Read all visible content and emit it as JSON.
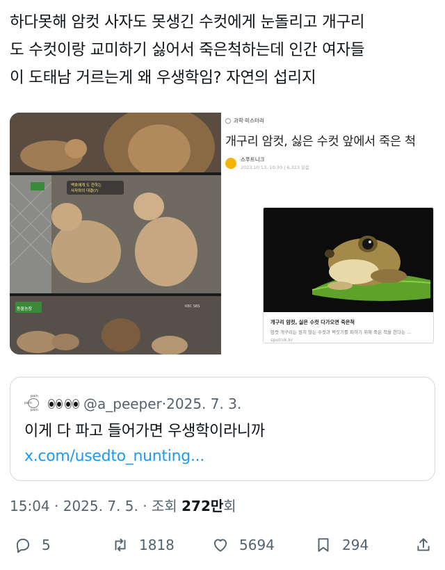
{
  "tweet": {
    "lines": [
      "하다못해 암컷 사자도 못생긴 수컷에게 눈돌리고 개구리",
      "도 수컷이랑 교미하기 싫어서 죽은척하는데 인간 여자들",
      "이 도태남 거르는게 왜 우생학임? 자연의 섭리지"
    ]
  },
  "media": {
    "lion_captions": [
      "백호에게 도 전하는",
      "사자와의 대결(?)"
    ],
    "tv_logo_text": "동물농장",
    "broadcaster": "KBC SBS",
    "article": {
      "category": "과학·미스터리",
      "title": "개구리 암컷, 싫은 수컷 앞에서 죽은 척",
      "publisher": "스푸트니크",
      "date_line": "2023.10.13. 10:30 | 6,323 읽음",
      "card_title": "개구리 암컷, 싫은 수컷 다가오면 죽은척",
      "card_desc": "암컷 개구리는 원치 않는 수컷과 짝짓기를 피하기 위해 죽은 척을 한다는 ...",
      "card_domain": "sputnik.kr"
    }
  },
  "quote": {
    "avatar_words": [
      "pain",
      "pain",
      "pain"
    ],
    "handle": "@a_peeper",
    "separator": "·",
    "date": "2025. 7. 3.",
    "text": "이게 다 파고 들어가면 우생학이라니까 ",
    "link": "x.com/usedto_nunting..."
  },
  "meta": {
    "time": "15:04",
    "date": "2025. 7. 5.",
    "views_label": "조회",
    "views_count": "272만",
    "views_suffix": "회",
    "separator": "·"
  },
  "actions": {
    "replies": "5",
    "reposts": "1818",
    "likes": "5694",
    "bookmarks": "294"
  },
  "colors": {
    "text": "#0f1419",
    "secondary": "#536471",
    "link": "#1d9bf0",
    "border": "#cfd9de"
  }
}
